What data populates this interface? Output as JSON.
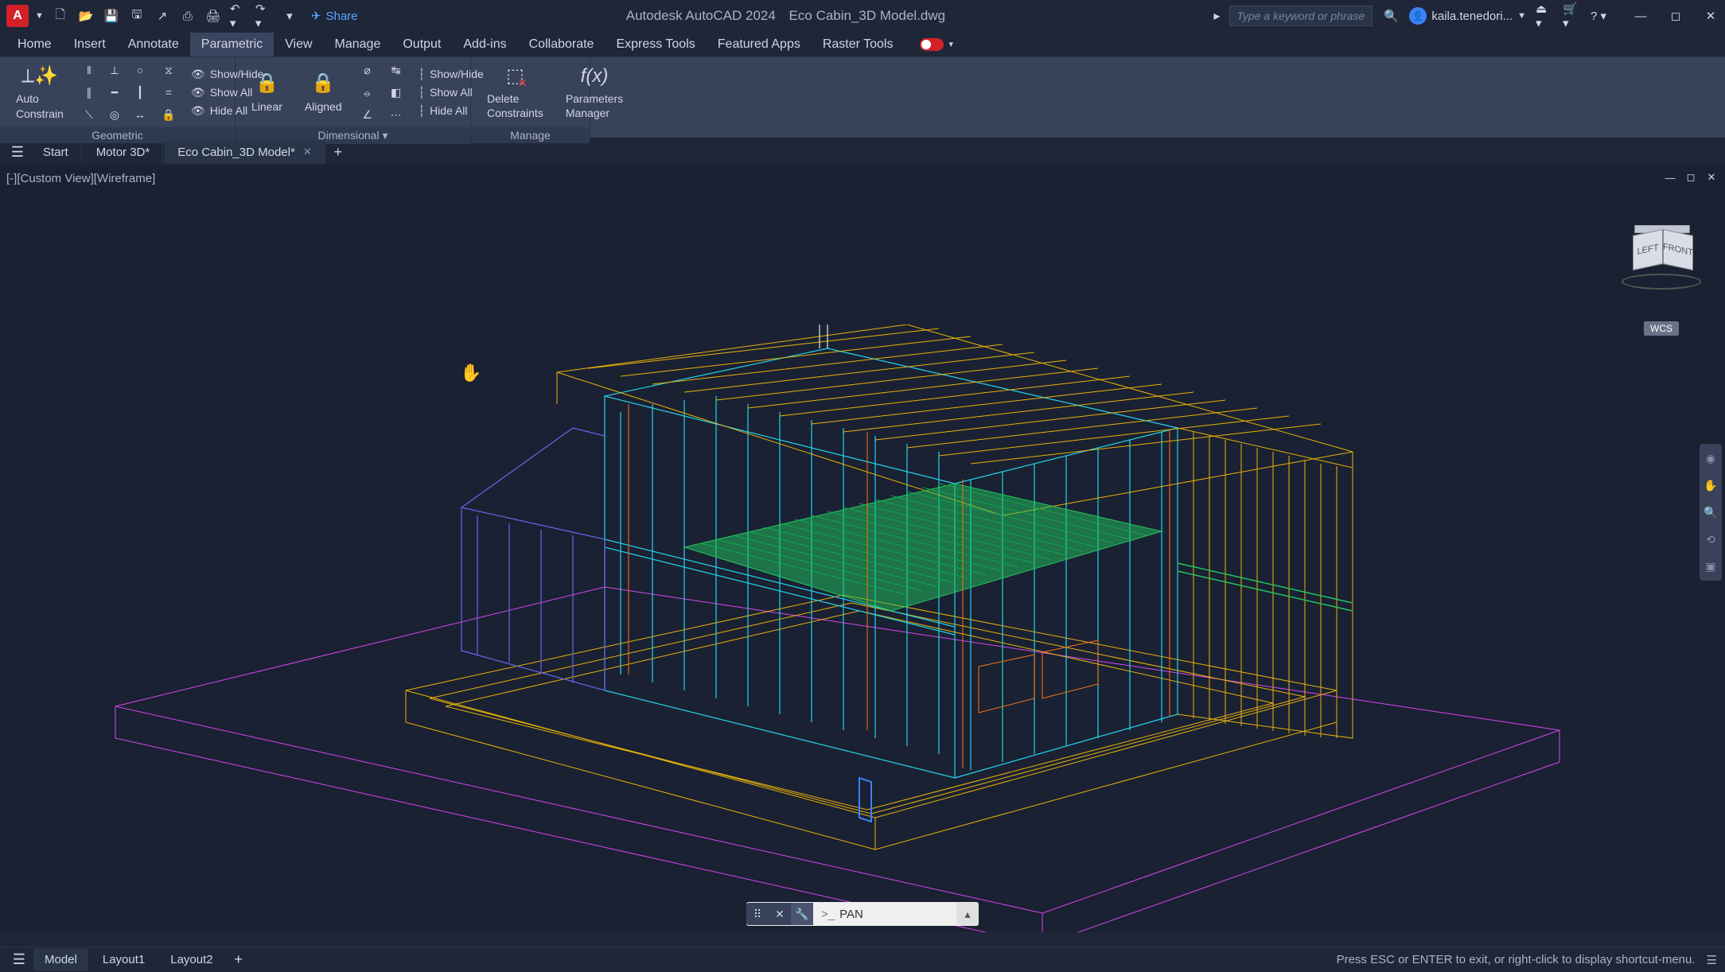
{
  "titlebar": {
    "app_name": "Autodesk AutoCAD 2024",
    "file_name": "Eco Cabin_3D Model.dwg",
    "share_label": "Share",
    "search_placeholder": "Type a keyword or phrase",
    "user_name": "kaila.tenedori...",
    "logo_letter": "A"
  },
  "menubar": {
    "items": [
      "Home",
      "Insert",
      "Annotate",
      "Parametric",
      "View",
      "Manage",
      "Output",
      "Add-ins",
      "Collaborate",
      "Express Tools",
      "Featured Apps",
      "Raster Tools"
    ],
    "active_index": 3
  },
  "ribbon": {
    "panels": [
      {
        "title": "Geometric",
        "auto_constrain_label": "Auto\nConstrain",
        "show_hide": "Show/Hide",
        "show_all": "Show All",
        "hide_all": "Hide All"
      },
      {
        "title": "Dimensional",
        "linear_label": "Linear",
        "aligned_label": "Aligned",
        "show_hide": "Show/Hide",
        "show_all": "Show All",
        "hide_all": "Hide All"
      },
      {
        "title": "Manage",
        "delete_constraints_label": "Delete\nConstraints",
        "parameters_manager_label": "Parameters\nManager"
      }
    ]
  },
  "filetabs": {
    "tabs": [
      {
        "label": "Start",
        "active": false,
        "closeable": false
      },
      {
        "label": "Motor 3D*",
        "active": false,
        "closeable": false
      },
      {
        "label": "Eco Cabin_3D Model*",
        "active": true,
        "closeable": true
      }
    ]
  },
  "viewport": {
    "label": "[-][Custom View][Wireframe]",
    "viewcube": {
      "left": "LEFT",
      "front": "FRONT",
      "wcs": "WCS"
    }
  },
  "cmdline": {
    "command": "PAN",
    "prompt": ">_"
  },
  "statusbar": {
    "layouts": [
      "Model",
      "Layout1",
      "Layout2"
    ],
    "active_layout_index": 0,
    "hint": "Press ESC or ENTER to exit, or right-click to display shortcut-menu."
  }
}
